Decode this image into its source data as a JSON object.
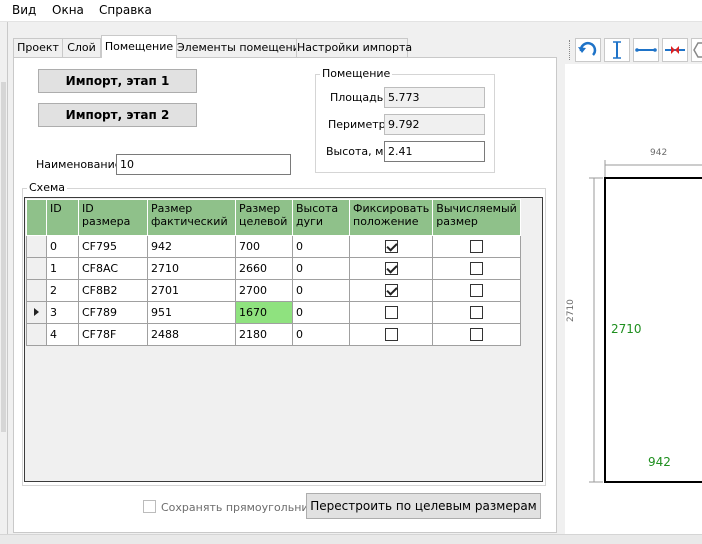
{
  "menu": [
    "Вид",
    "Окна",
    "Справка"
  ],
  "tabs": [
    "Проект",
    "Слой",
    "Помещение",
    "Элементы помещения",
    "Настройки импорта"
  ],
  "active_tab": 2,
  "buttons": {
    "import1": "Импорт, этап 1",
    "import2": "Импорт, этап 2",
    "rebuild": "Перестроить по целевым размерам"
  },
  "room_group": {
    "title": "Помещение",
    "area_label": "Площадь",
    "area_value": "5.773",
    "perimeter_label": "Периметр",
    "perimeter_value": "9.792",
    "height_label": "Высота, м",
    "height_value": "2.41"
  },
  "name_label": "Наименование",
  "name_value": "10",
  "schema_title": "Схема",
  "grid": {
    "columns": [
      "ID",
      "ID\nразмера",
      "Размер\nфактический",
      "Размер\nцелевой",
      "Высота\nдуги",
      "Фиксировать\nположение",
      "Вычисляемый\nразмер"
    ],
    "rows": [
      {
        "id": "0",
        "size_id": "CF795",
        "actual": "942",
        "target": "700",
        "arc": "0",
        "fix": true,
        "calc": false
      },
      {
        "id": "1",
        "size_id": "CF8AC",
        "actual": "2710",
        "target": "2660",
        "arc": "0",
        "fix": true,
        "calc": false
      },
      {
        "id": "2",
        "size_id": "CF8B2",
        "actual": "2701",
        "target": "2700",
        "arc": "0",
        "fix": true,
        "calc": false
      },
      {
        "id": "3",
        "size_id": "CF789",
        "actual": "951",
        "target": "1670",
        "arc": "0",
        "fix": false,
        "calc": false
      },
      {
        "id": "4",
        "size_id": "CF78F",
        "actual": "2488",
        "target": "2180",
        "arc": "0",
        "fix": false,
        "calc": false
      }
    ],
    "current_row": 3,
    "highlight_row": 3
  },
  "keep_rect_label": "Сохранять прямоугольник",
  "drawing": {
    "top_dim": "942",
    "left_dim": "2710",
    "inner_left": "2710",
    "inner_bottom": "942"
  }
}
